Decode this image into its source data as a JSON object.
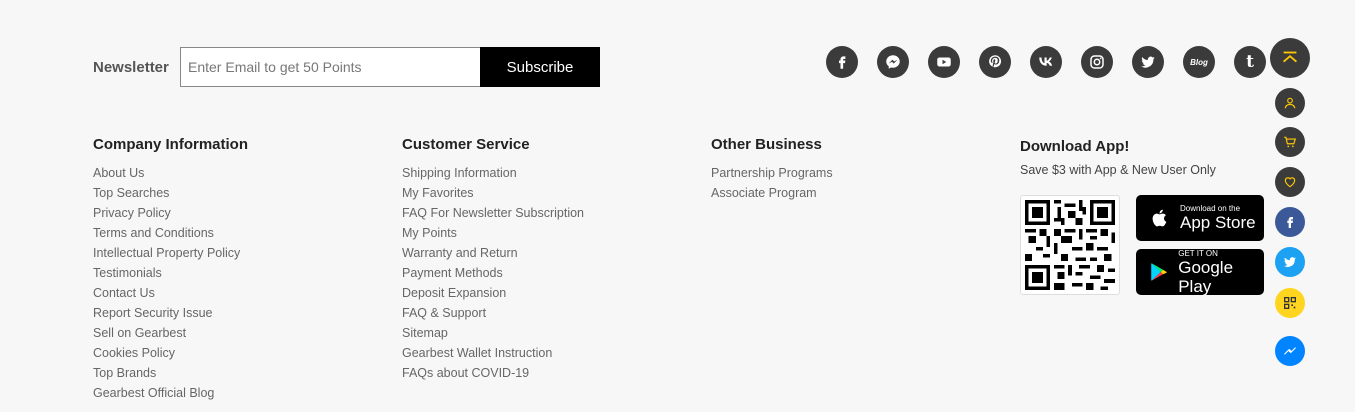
{
  "newsletter": {
    "label": "Newsletter",
    "placeholder": "Enter Email to get 50 Points",
    "button": "Subscribe"
  },
  "social": {
    "blog_label": "Blog",
    "tumblr_label": "t"
  },
  "company": {
    "title": "Company Information",
    "items": [
      "About Us",
      "Top Searches",
      "Privacy Policy",
      "Terms and Conditions",
      "Intellectual Property Policy",
      "Testimonials",
      "Contact Us",
      "Report Security Issue",
      "Sell on Gearbest",
      "Cookies Policy",
      "Top Brands",
      "Gearbest Official Blog"
    ]
  },
  "service": {
    "title": "Customer Service",
    "items": [
      "Shipping Information",
      "My Favorites",
      "FAQ For Newsletter Subscription",
      "My Points",
      "Warranty and Return",
      "Payment Methods",
      "Deposit Expansion",
      "FAQ & Support",
      "Sitemap",
      "Gearbest Wallet Instruction",
      "FAQs about COVID-19"
    ]
  },
  "other": {
    "title": "Other Business",
    "items": [
      "Partnership Programs",
      "Associate Program"
    ]
  },
  "app": {
    "title": "Download App!",
    "subtitle": "Save $3 with App & New User Only",
    "appstore_small": "Download on the",
    "appstore_big": "App Store",
    "google_small": "GET IT ON",
    "google_big": "Google Play"
  },
  "colors": {
    "accent": "#ffc800",
    "dark": "#3b3b3b",
    "facebook": "#3b5998",
    "twitter": "#1da1f2",
    "messenger": "#0084ff"
  }
}
